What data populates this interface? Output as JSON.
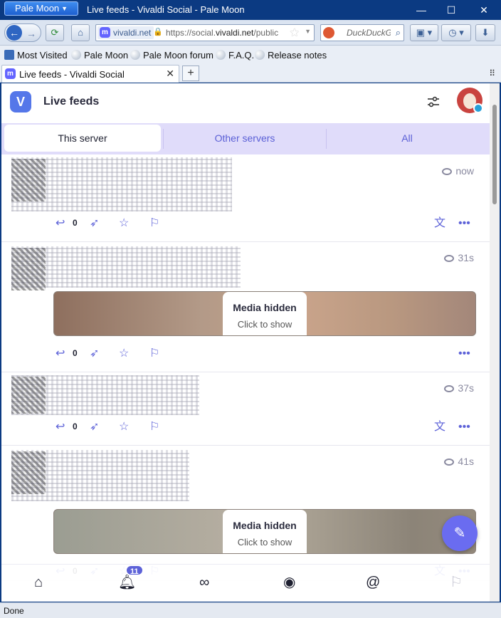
{
  "window": {
    "app_menu": "Pale Moon",
    "title": "Live feeds - Vivaldi Social - Pale Moon",
    "minimize": "—",
    "maximize": "☐",
    "close": "✕"
  },
  "navbar": {
    "site_identity": "vivaldi.net",
    "url_prefix": "https://social.",
    "url_domain": "vivaldi.net",
    "url_suffix": "/public",
    "search_placeholder": "DuckDuckGo"
  },
  "bookmarks": [
    "Most Visited",
    "Pale Moon",
    "Pale Moon forum",
    "F.A.Q.",
    "Release notes"
  ],
  "tab": {
    "title": "Live feeds - Vivaldi Social",
    "close": "✕",
    "new": "+"
  },
  "app": {
    "title": "Live feeds",
    "feed_tabs": [
      "This server",
      "Other servers",
      "All"
    ]
  },
  "posts": [
    {
      "time": "now",
      "reply_count": "0",
      "has_translate": true,
      "media": null
    },
    {
      "time": "31s",
      "reply_count": "0",
      "has_translate": false,
      "media": {
        "title": "Media hidden",
        "action": "Click to show"
      }
    },
    {
      "time": "37s",
      "reply_count": "0",
      "has_translate": true,
      "media": null
    },
    {
      "time": "41s",
      "reply_count": "0",
      "has_translate": true,
      "media": {
        "title": "Media hidden",
        "action": "Click to show"
      }
    }
  ],
  "bottom_nav": {
    "notification_count": "11"
  },
  "icons": {
    "reply": "reply-icon",
    "boost": "rocket-icon",
    "favourite": "star-icon",
    "bookmark": "bookmark-icon",
    "translate": "translate-icon",
    "more": "more-icon",
    "compose": "feather-icon",
    "home": "home-icon",
    "notifications": "bell-icon",
    "explore": "binoculars-icon",
    "live": "planet-icon",
    "mentions": "at-icon"
  },
  "colors": {
    "accent": "#5d62d8",
    "tabs_bg": "#e0dcfa",
    "chrome": "#0b3a82"
  },
  "status": "Done"
}
